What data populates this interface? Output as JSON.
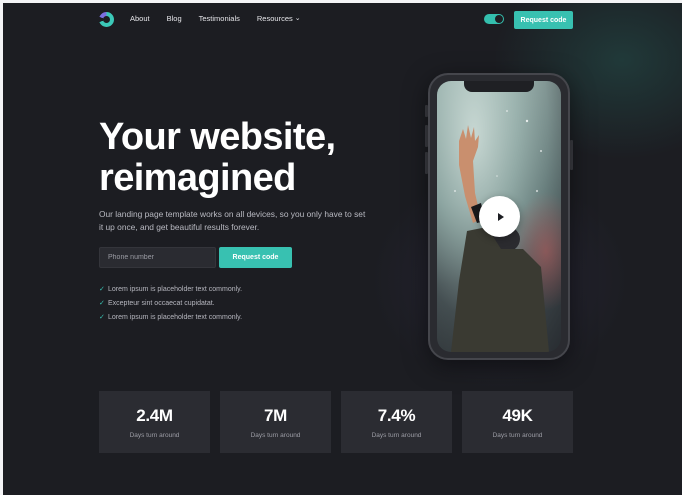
{
  "header": {
    "nav": [
      {
        "label": "About"
      },
      {
        "label": "Blog"
      },
      {
        "label": "Testimonials"
      },
      {
        "label": "Resources"
      }
    ],
    "cta_label": "Request code",
    "logo_icon": "logo-ring-icon"
  },
  "hero": {
    "title_line1": "Your website,",
    "title_line2": "reimagined",
    "subtitle": "Our landing page template works on all devices, so you only have to set it up once, and get beautiful results forever.",
    "phone_placeholder": "Phone number",
    "cta_label": "Request code",
    "checks": [
      {
        "text": "Lorem ipsum is placeholder text commonly."
      },
      {
        "text": "Excepteur sint occaecat cupidatat."
      },
      {
        "text": "Lorem ipsum is placeholder text commonly."
      }
    ]
  },
  "media": {
    "play_icon": "play-icon"
  },
  "stats": [
    {
      "value": "2.4M",
      "label": "Days turn around"
    },
    {
      "value": "7M",
      "label": "Days turn around"
    },
    {
      "value": "7.4%",
      "label": "Days turn around"
    },
    {
      "value": "49K",
      "label": "Days turn around"
    }
  ],
  "colors": {
    "accent": "#38c1b1",
    "background": "#1c1d22",
    "card": "#2b2c32"
  }
}
